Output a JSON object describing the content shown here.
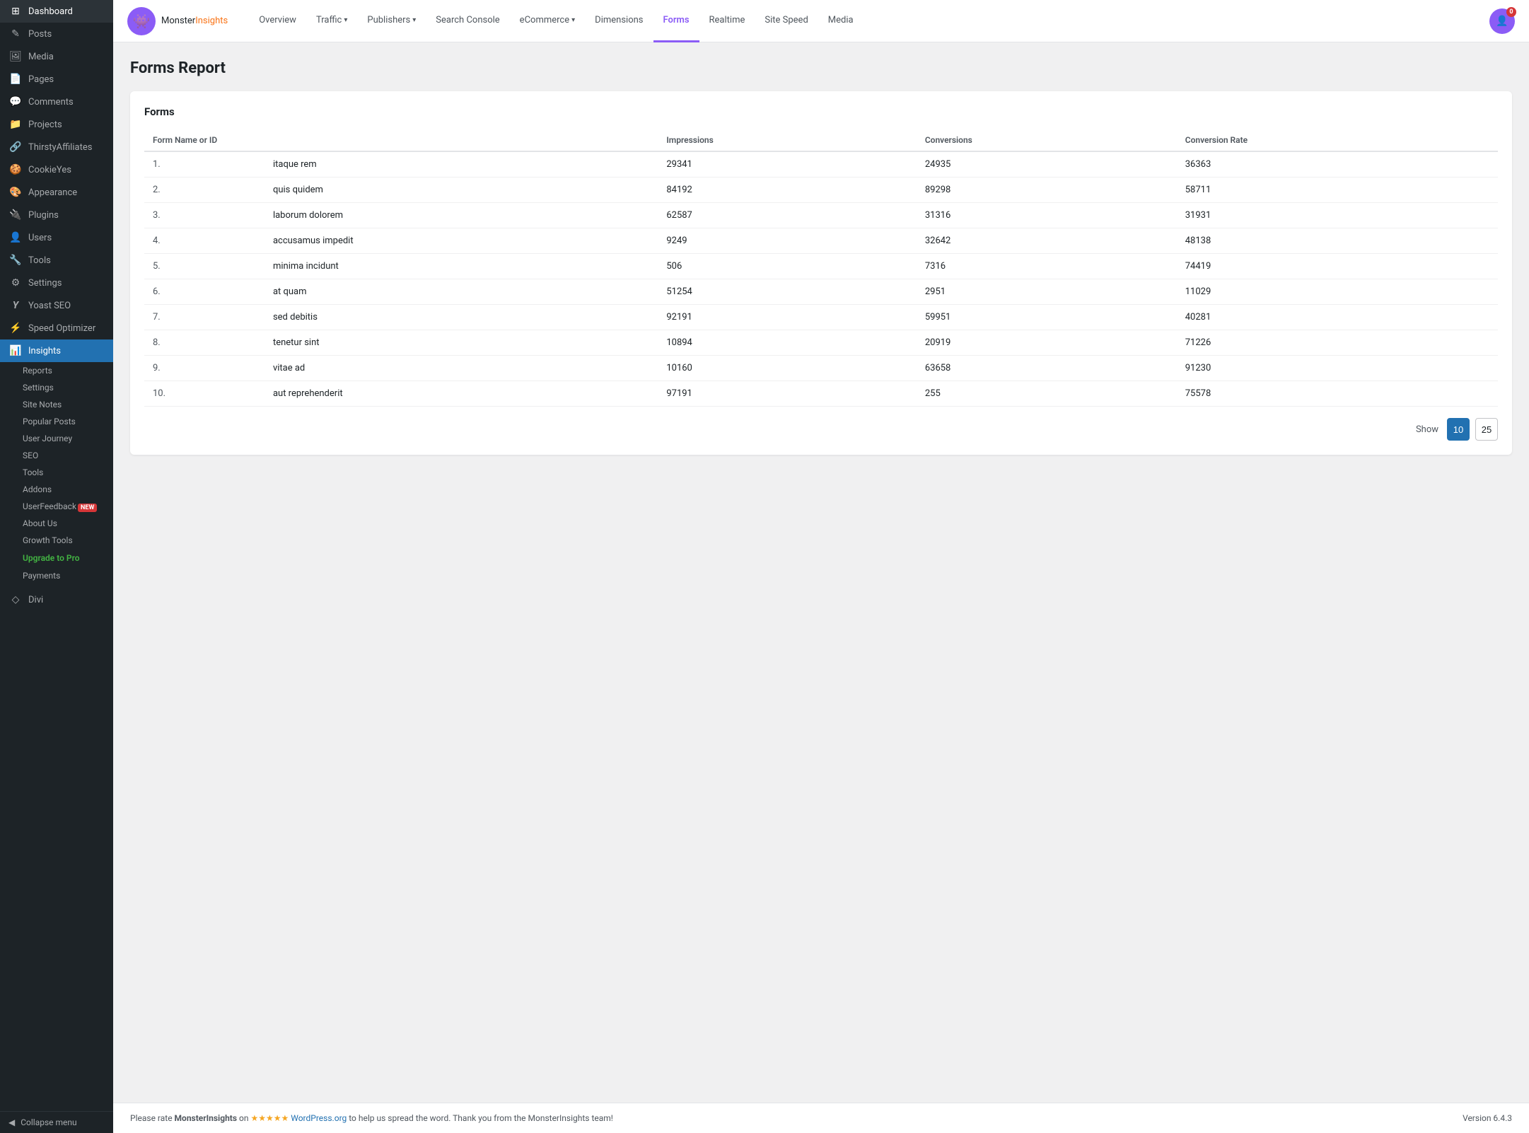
{
  "sidebar": {
    "items": [
      {
        "label": "Dashboard",
        "icon": "⊞",
        "active": false
      },
      {
        "label": "Posts",
        "icon": "✎",
        "active": false
      },
      {
        "label": "Media",
        "icon": "🖼",
        "active": false
      },
      {
        "label": "Pages",
        "icon": "📄",
        "active": false
      },
      {
        "label": "Comments",
        "icon": "💬",
        "active": false
      },
      {
        "label": "Projects",
        "icon": "📁",
        "active": false
      },
      {
        "label": "ThirstyAffiliates",
        "icon": "🔗",
        "active": false
      },
      {
        "label": "CookieYes",
        "icon": "🍪",
        "active": false
      },
      {
        "label": "Appearance",
        "icon": "🎨",
        "active": false
      },
      {
        "label": "Plugins",
        "icon": "🔌",
        "active": false
      },
      {
        "label": "Users",
        "icon": "👤",
        "active": false
      },
      {
        "label": "Tools",
        "icon": "🔧",
        "active": false
      },
      {
        "label": "Settings",
        "icon": "⚙",
        "active": false
      },
      {
        "label": "Yoast SEO",
        "icon": "Y",
        "active": false
      },
      {
        "label": "Speed Optimizer",
        "icon": "⚡",
        "active": false
      },
      {
        "label": "Insights",
        "icon": "📊",
        "active": true
      }
    ],
    "sub_items": [
      {
        "label": "Reports",
        "active": false
      },
      {
        "label": "Settings",
        "active": false
      },
      {
        "label": "Site Notes",
        "active": false
      },
      {
        "label": "Popular Posts",
        "active": false
      },
      {
        "label": "User Journey",
        "active": false
      },
      {
        "label": "SEO",
        "active": false
      },
      {
        "label": "Tools",
        "active": false
      },
      {
        "label": "Addons",
        "active": false
      },
      {
        "label": "UserFeedback",
        "badge": "NEW",
        "active": false
      },
      {
        "label": "About Us",
        "active": false
      },
      {
        "label": "Growth Tools",
        "active": false
      }
    ],
    "upgrade_label": "Upgrade to Pro",
    "payments_label": "Payments",
    "divi_label": "Divi",
    "collapse_label": "Collapse menu"
  },
  "topbar": {
    "logo_monster": "Monster",
    "logo_insights": "Insights",
    "logo_icon": "👾",
    "avatar_badge": "0",
    "nav_tabs": [
      {
        "label": "Overview",
        "active": false,
        "has_dropdown": false
      },
      {
        "label": "Traffic",
        "active": false,
        "has_dropdown": true
      },
      {
        "label": "Publishers",
        "active": false,
        "has_dropdown": true
      },
      {
        "label": "Search Console",
        "active": false,
        "has_dropdown": false
      },
      {
        "label": "eCommerce",
        "active": false,
        "has_dropdown": true
      },
      {
        "label": "Dimensions",
        "active": false,
        "has_dropdown": false
      },
      {
        "label": "Forms",
        "active": true,
        "has_dropdown": false
      },
      {
        "label": "Realtime",
        "active": false,
        "has_dropdown": false
      },
      {
        "label": "Site Speed",
        "active": false,
        "has_dropdown": false
      },
      {
        "label": "Media",
        "active": false,
        "has_dropdown": false
      }
    ]
  },
  "page": {
    "title": "Forms Report",
    "card_title": "Forms",
    "columns": [
      {
        "label": "Form Name or ID"
      },
      {
        "label": "Impressions"
      },
      {
        "label": "Conversions"
      },
      {
        "label": "Conversion Rate"
      }
    ],
    "rows": [
      {
        "num": "1.",
        "name": "itaque rem",
        "impressions": "29341",
        "conversions": "24935",
        "rate": "36363"
      },
      {
        "num": "2.",
        "name": "quis quidem",
        "impressions": "84192",
        "conversions": "89298",
        "rate": "58711"
      },
      {
        "num": "3.",
        "name": "laborum dolorem",
        "impressions": "62587",
        "conversions": "31316",
        "rate": "31931"
      },
      {
        "num": "4.",
        "name": "accusamus impedit",
        "impressions": "9249",
        "conversions": "32642",
        "rate": "48138"
      },
      {
        "num": "5.",
        "name": "minima incidunt",
        "impressions": "506",
        "conversions": "7316",
        "rate": "74419"
      },
      {
        "num": "6.",
        "name": "at quam",
        "impressions": "51254",
        "conversions": "2951",
        "rate": "11029"
      },
      {
        "num": "7.",
        "name": "sed debitis",
        "impressions": "92191",
        "conversions": "59951",
        "rate": "40281"
      },
      {
        "num": "8.",
        "name": "tenetur sint",
        "impressions": "10894",
        "conversions": "20919",
        "rate": "71226"
      },
      {
        "num": "9.",
        "name": "vitae ad",
        "impressions": "10160",
        "conversions": "63658",
        "rate": "91230"
      },
      {
        "num": "10.",
        "name": "aut reprehenderit",
        "impressions": "97191",
        "conversions": "255",
        "rate": "75578"
      }
    ],
    "pagination": {
      "show_label": "Show",
      "btn_10": "10",
      "btn_25": "25"
    }
  },
  "footer": {
    "pre_text": "Please rate ",
    "brand": "MonsterInsights",
    "mid_text": " on ",
    "stars": "★★★★★",
    "link_text": "WordPress.org",
    "post_text": " to help us spread the word. Thank you from the MonsterInsights team!",
    "version": "Version 6.4.3"
  }
}
